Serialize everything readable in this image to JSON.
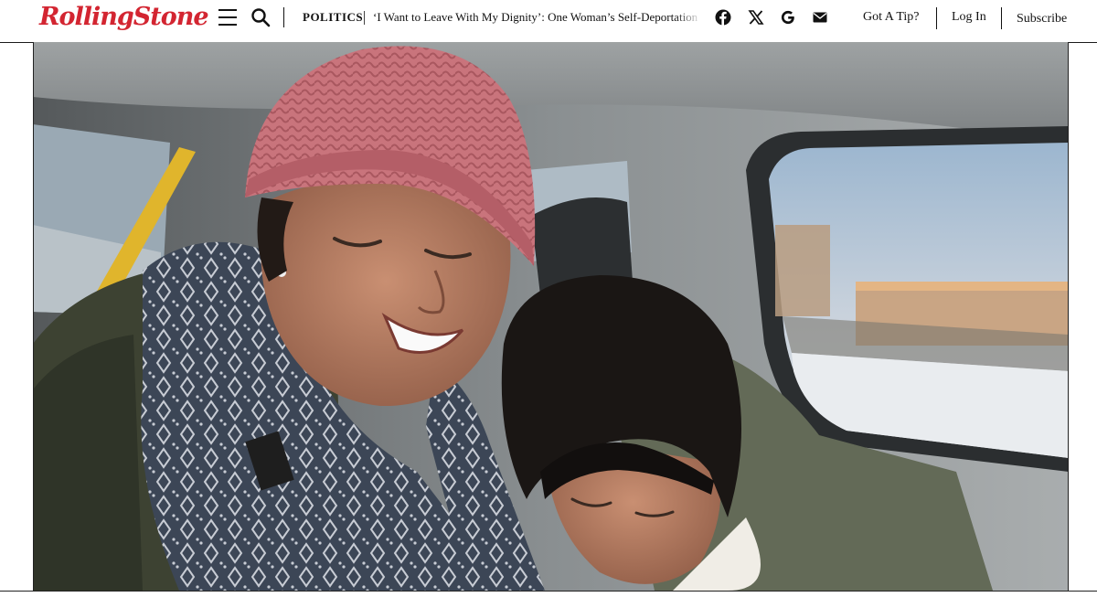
{
  "header": {
    "logo_text": "RollingStone",
    "section": "POLITICS",
    "article_title": "‘I Want to Leave With My Dignity’: One Woman’s Self-Deportation",
    "tip_label": "Got A Tip?",
    "login_label": "Log In",
    "subscribe_label": "Subscribe",
    "icons": {
      "menu": "hamburger-menu-icon",
      "search": "search-icon",
      "facebook": "facebook-icon",
      "x": "x-twitter-icon",
      "google": "google-icon",
      "email": "email-icon"
    }
  },
  "hero": {
    "alt": "A woman in a pink knit beanie and patterned scarf smiles with eyes closed while hugging a crying girl in the back seat of a car."
  },
  "colors": {
    "brand_red": "#d32531",
    "text": "#111111",
    "beanie": "#c9747c"
  }
}
